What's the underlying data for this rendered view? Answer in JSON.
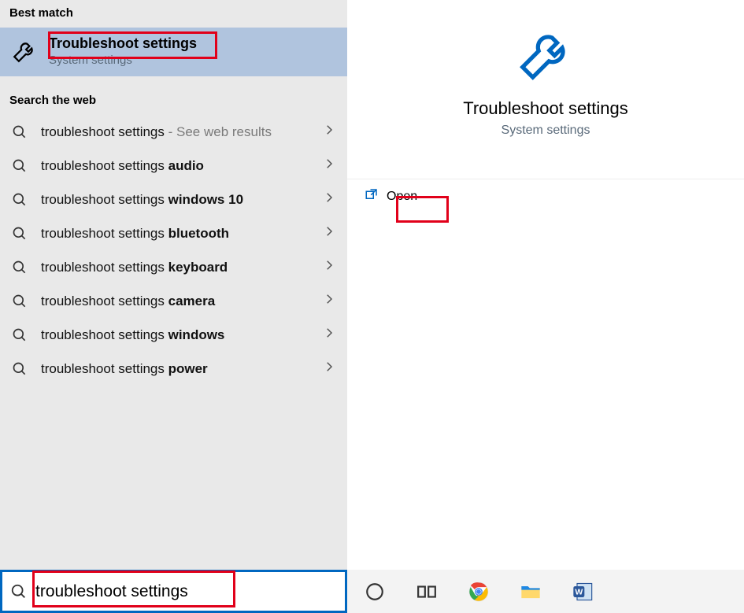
{
  "left": {
    "best_match_header": "Best match",
    "best_match": {
      "title": "Troubleshoot settings",
      "subtitle": "System settings"
    },
    "web_header": "Search the web",
    "web_items": [
      {
        "prefix": "troubleshoot settings",
        "bold": "",
        "suffix": " - See web results"
      },
      {
        "prefix": "troubleshoot settings ",
        "bold": "audio",
        "suffix": ""
      },
      {
        "prefix": "troubleshoot settings ",
        "bold": "windows 10",
        "suffix": ""
      },
      {
        "prefix": "troubleshoot settings ",
        "bold": "bluetooth",
        "suffix": ""
      },
      {
        "prefix": "troubleshoot settings ",
        "bold": "keyboard",
        "suffix": ""
      },
      {
        "prefix": "troubleshoot settings ",
        "bold": "camera",
        "suffix": ""
      },
      {
        "prefix": "troubleshoot settings ",
        "bold": "windows",
        "suffix": ""
      },
      {
        "prefix": "troubleshoot settings ",
        "bold": "power",
        "suffix": ""
      }
    ],
    "search_value": "troubleshoot settings"
  },
  "right": {
    "title": "Troubleshoot settings",
    "subtitle": "System settings",
    "action_open": "Open"
  },
  "icons": {
    "wrench": "wrench-icon",
    "search": "search-icon",
    "chevron": "chevron-right-icon",
    "open_arrow": "open-external-icon"
  },
  "taskbar": {
    "cortana": "cortana-icon",
    "taskview": "taskview-icon",
    "chrome": "chrome-icon",
    "explorer": "file-explorer-icon",
    "word": "word-icon"
  }
}
